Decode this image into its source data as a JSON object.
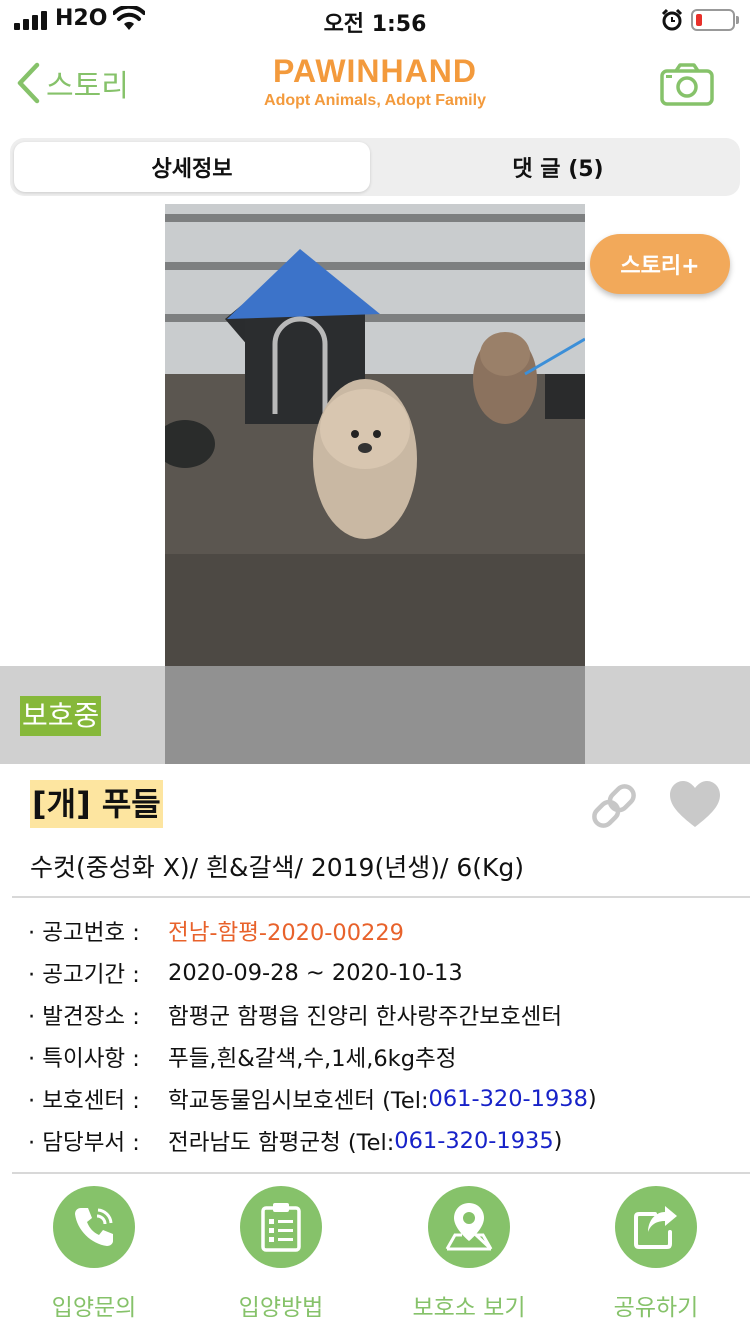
{
  "status_bar": {
    "carrier": "H2O",
    "time": "오전 1:56"
  },
  "nav": {
    "back_label": "스토리",
    "logo_title": "PAWINHAND",
    "logo_subtitle": "Adopt Animals, Adopt Family",
    "camera_icon": "camera-icon"
  },
  "tabs": [
    {
      "label": "상세정보",
      "active": true
    },
    {
      "label": "댓 글 (5)",
      "active": false
    }
  ],
  "story_plus_label": "스토리+",
  "status_label": "보호중",
  "animal": {
    "title": "[개] 푸들",
    "summary": "수컷(중성화 X)/ 흰&갈색/ 2019(년생)/ 6(Kg)"
  },
  "info": {
    "notice_no_label": "· 공고번호 :",
    "notice_no": "전남-함평-2020-00229",
    "period_label": "· 공고기간 :",
    "period": "2020-09-28 ~ 2020-10-13",
    "found_label": "· 발견장소 :",
    "found": "함평군 함평읍 진양리 한사랑주간보호센터",
    "special_label": "· 특이사항 :",
    "special": "푸들,흰&갈색,수,1세,6kg추정",
    "shelter_label": "· 보호센터 :",
    "shelter_name": "학교동물임시보호센터 (Tel: ",
    "shelter_tel": "061-320-1938",
    "shelter_close": ")",
    "dept_label": "· 담당부서 :",
    "dept_name": "전라남도 함평군청 (Tel: ",
    "dept_tel": "061-320-1935",
    "dept_close": ")"
  },
  "actions": {
    "inquiry": "입양문의",
    "method": "입양방법",
    "shelter": "보호소 보기",
    "share": "공유하기"
  },
  "colors": {
    "brand_orange": "#f39a3c",
    "accent_green": "#86c26a",
    "status_green": "#86b83a",
    "link_blue": "#1722c8",
    "notice_orange": "#e8622b"
  }
}
